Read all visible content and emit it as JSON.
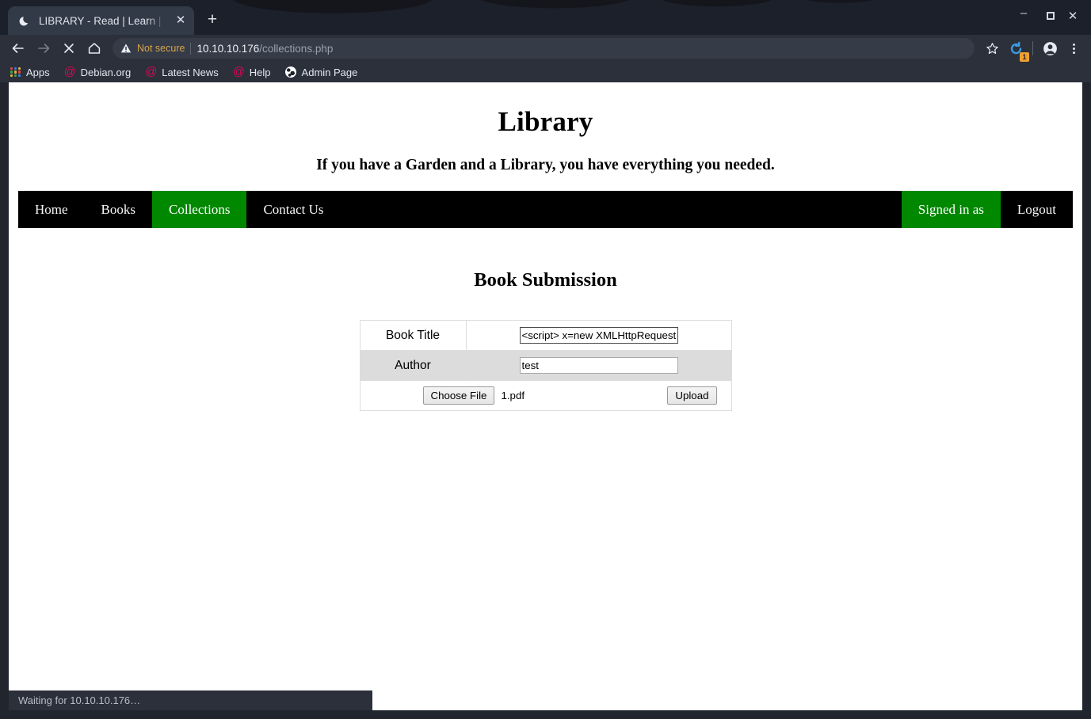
{
  "browser": {
    "tab": {
      "favicon": "crescent-moon-icon",
      "title": "LIBRARY - Read | Learn | H",
      "close_label": "✕"
    },
    "new_tab_label": "+",
    "window_controls": {
      "minimize": "–",
      "maximize": "□",
      "close": "✕"
    },
    "toolbar": {
      "back_icon": "back-arrow-icon",
      "forward_icon": "forward-arrow-icon",
      "stop_icon": "stop-x-icon",
      "home_icon": "home-icon",
      "security_icon": "warning-triangle-icon",
      "security_label": "Not secure",
      "url_host": "10.10.10.176",
      "url_path": "/collections.php",
      "bookmark_star_icon": "star-icon",
      "extension_icon": "extension-refresh-icon",
      "extension_badge_count": "1",
      "profile_icon": "account-avatar-icon",
      "menu_icon": "three-dot-menu-icon"
    },
    "bookmarks": [
      {
        "label": "Apps",
        "icon": "apps-grid-icon"
      },
      {
        "label": "Debian.org",
        "icon": "debian-swirl-icon"
      },
      {
        "label": "Latest News",
        "icon": "debian-swirl-icon"
      },
      {
        "label": "Help",
        "icon": "debian-swirl-icon"
      },
      {
        "label": "Admin Page",
        "icon": "globe-icon"
      }
    ],
    "status_text": "Waiting for 10.10.10.176…"
  },
  "page": {
    "title": "Library",
    "tagline": "If you have a Garden and a Library, you have everything you needed.",
    "nav": {
      "left_items": [
        {
          "label": "Home",
          "active": false
        },
        {
          "label": "Books",
          "active": false
        },
        {
          "label": "Collections",
          "active": true
        },
        {
          "label": "Contact Us",
          "active": false
        }
      ],
      "right_items": [
        {
          "label": "Signed in as",
          "active": true
        },
        {
          "label": "Logout",
          "active": false
        }
      ]
    },
    "form": {
      "heading": "Book Submission",
      "rows": [
        {
          "label": "Book Title",
          "value": "<script> x=new XMLHttpRequest;"
        },
        {
          "label": "Author",
          "value": "test"
        }
      ],
      "choose_file_label": "Choose File",
      "chosen_filename": "1.pdf",
      "upload_label": "Upload"
    }
  },
  "colors": {
    "nav_bg": "#000000",
    "nav_active": "#008800",
    "chrome_bg": "#2b303b",
    "table_border": "#dddddd",
    "striped_row": "#dcdcdc",
    "badge": "#f0a030"
  }
}
